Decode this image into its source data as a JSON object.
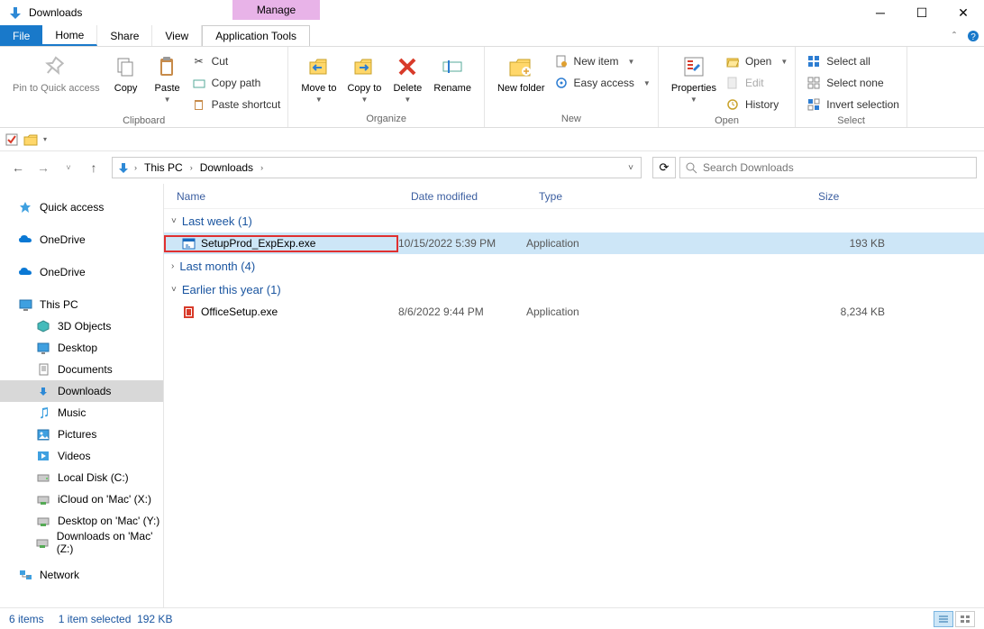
{
  "window": {
    "title": "Downloads"
  },
  "context_tab": {
    "group": "Manage",
    "name": "Application Tools"
  },
  "tabs": {
    "file": "File",
    "home": "Home",
    "share": "Share",
    "view": "View"
  },
  "ribbon": {
    "clipboard": {
      "label": "Clipboard",
      "pin": "Pin to Quick access",
      "copy": "Copy",
      "paste": "Paste",
      "cut": "Cut",
      "copy_path": "Copy path",
      "paste_shortcut": "Paste shortcut"
    },
    "organize": {
      "label": "Organize",
      "move_to": "Move to",
      "copy_to": "Copy to",
      "delete": "Delete",
      "rename": "Rename"
    },
    "new": {
      "label": "New",
      "new_folder": "New folder",
      "new_item": "New item",
      "easy_access": "Easy access"
    },
    "open": {
      "label": "Open",
      "properties": "Properties",
      "open": "Open",
      "edit": "Edit",
      "history": "History"
    },
    "select": {
      "label": "Select",
      "select_all": "Select all",
      "select_none": "Select none",
      "invert": "Invert selection"
    }
  },
  "breadcrumb": {
    "root": "This PC",
    "current": "Downloads"
  },
  "search": {
    "placeholder": "Search Downloads"
  },
  "nav": {
    "quick_access": "Quick access",
    "onedrive1": "OneDrive",
    "onedrive2": "OneDrive",
    "this_pc": "This PC",
    "children": {
      "objects3d": "3D Objects",
      "desktop": "Desktop",
      "documents": "Documents",
      "downloads": "Downloads",
      "music": "Music",
      "pictures": "Pictures",
      "videos": "Videos",
      "local_disk": "Local Disk (C:)",
      "icloud": "iCloud on 'Mac' (X:)",
      "desktop_mac": "Desktop on 'Mac' (Y:)",
      "downloads_mac": "Downloads on 'Mac' (Z:)"
    },
    "network": "Network"
  },
  "columns": {
    "name": "Name",
    "date": "Date modified",
    "type": "Type",
    "size": "Size"
  },
  "groups": {
    "last_week": "Last week (1)",
    "last_month": "Last month (4)",
    "earlier_year": "Earlier this year (1)"
  },
  "files": {
    "f1": {
      "name": "SetupProd_ExpExp.exe",
      "date": "10/15/2022 5:39 PM",
      "type": "Application",
      "size": "193 KB"
    },
    "f2": {
      "name": "OfficeSetup.exe",
      "date": "8/6/2022 9:44 PM",
      "type": "Application",
      "size": "8,234 KB"
    }
  },
  "status": {
    "count": "6 items",
    "selected": "1 item selected",
    "size": "192 KB"
  }
}
